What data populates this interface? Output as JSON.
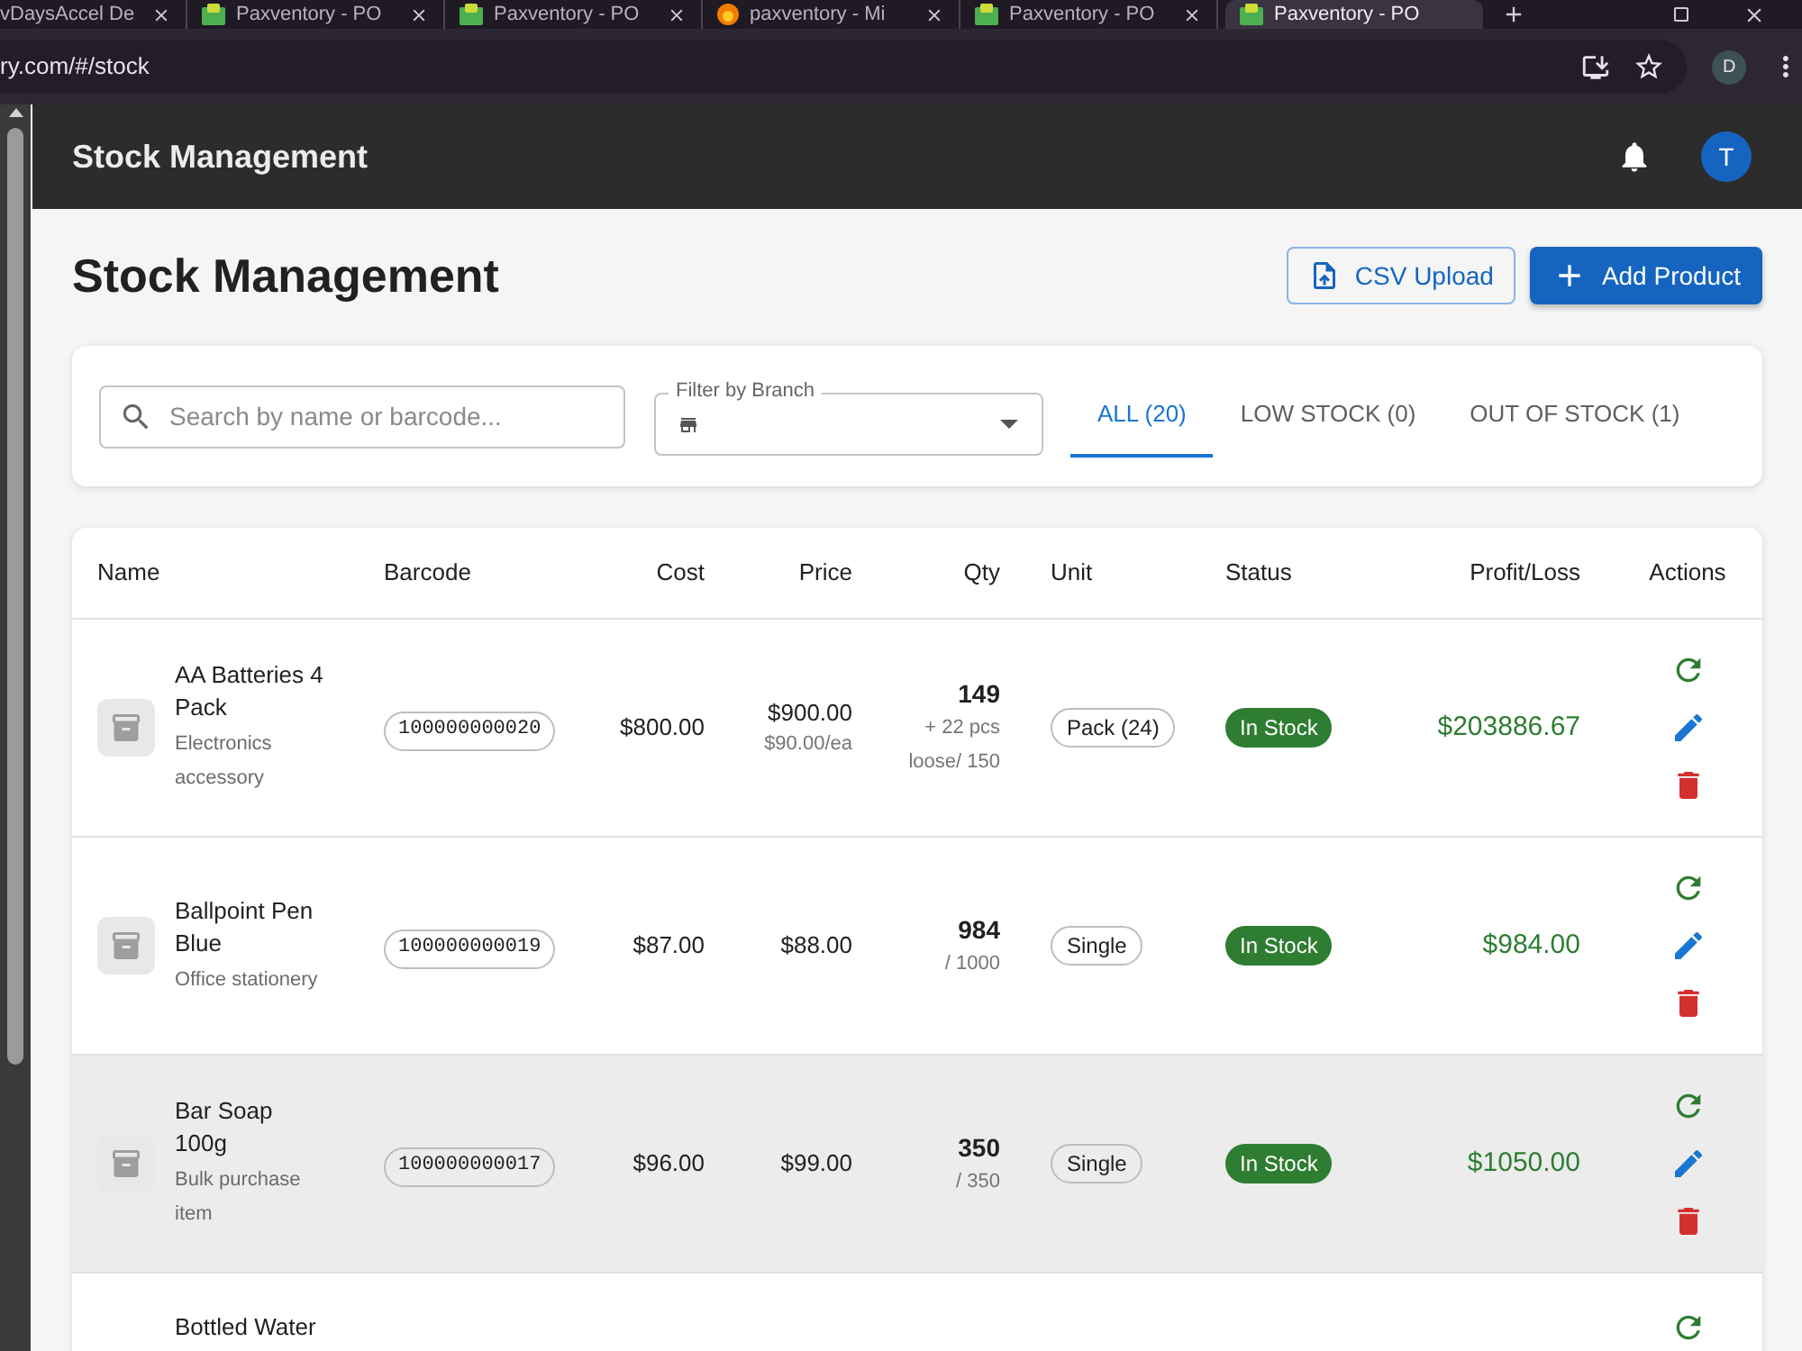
{
  "browser": {
    "tabs": [
      {
        "title": "vDaysAccel De",
        "kind": "plain",
        "selected": false
      },
      {
        "title": "Paxventory - PO",
        "kind": "app",
        "selected": false
      },
      {
        "title": "Paxventory - PO",
        "kind": "app",
        "selected": false
      },
      {
        "title": "paxventory - Mi",
        "kind": "site",
        "selected": false
      },
      {
        "title": "Paxventory - PO",
        "kind": "app",
        "selected": false
      },
      {
        "title": "Paxventory - PO",
        "kind": "app",
        "selected": true
      }
    ],
    "address": "ry.com/#/stock",
    "profile_initial": "D"
  },
  "app_bar": {
    "title": "Stock Management",
    "avatar_initial": "T"
  },
  "page": {
    "heading": "Stock Management",
    "buttons": [
      {
        "label": "CSV Upload",
        "kind": "outlined"
      },
      {
        "label": "Add Product",
        "kind": "contained"
      }
    ]
  },
  "filters": {
    "search": {
      "placeholder": "Search by name or barcode..."
    },
    "branch": {
      "label": "Filter by Branch"
    },
    "tabs": [
      {
        "label": "ALL (20)",
        "selected": true
      },
      {
        "label": "LOW STOCK (0)",
        "selected": false
      },
      {
        "label": "OUT OF STOCK (1)",
        "selected": false
      }
    ]
  },
  "table": {
    "columns": [
      "Name",
      "Barcode",
      "Cost",
      "Price",
      "Qty",
      "Unit",
      "Status",
      "Profit/Loss",
      "Actions"
    ],
    "rows": [
      {
        "partial": false,
        "highlighted": false,
        "name": "AA Batteries 4 Pack",
        "description": "Electronics accessory",
        "barcode": "100000000020",
        "cost": "$800.00",
        "price": "$900.00",
        "unit_price": "$90.00/ea",
        "qty": "149",
        "qty_detail": "+ 22 pcs loose/ 150",
        "unit": "Pack (24)",
        "status": "In Stock",
        "profit": "$203886.67"
      },
      {
        "partial": false,
        "highlighted": false,
        "name": "Ballpoint Pen Blue",
        "description": "Office stationery",
        "barcode": "100000000019",
        "cost": "$87.00",
        "price": "$88.00",
        "qty": "984",
        "qty_detail": "/ 1000",
        "unit": "Single",
        "status": "In Stock",
        "profit": "$984.00"
      },
      {
        "partial": false,
        "highlighted": true,
        "name": "Bar Soap 100g",
        "description": "Bulk purchase item",
        "barcode": "100000000017",
        "cost": "$96.00",
        "price": "$99.00",
        "qty": "350",
        "qty_detail": "/ 350",
        "unit": "Single",
        "status": "In Stock",
        "profit": "$1050.00"
      },
      {
        "partial": true,
        "highlighted": false,
        "name": "Bottled Water"
      }
    ]
  }
}
